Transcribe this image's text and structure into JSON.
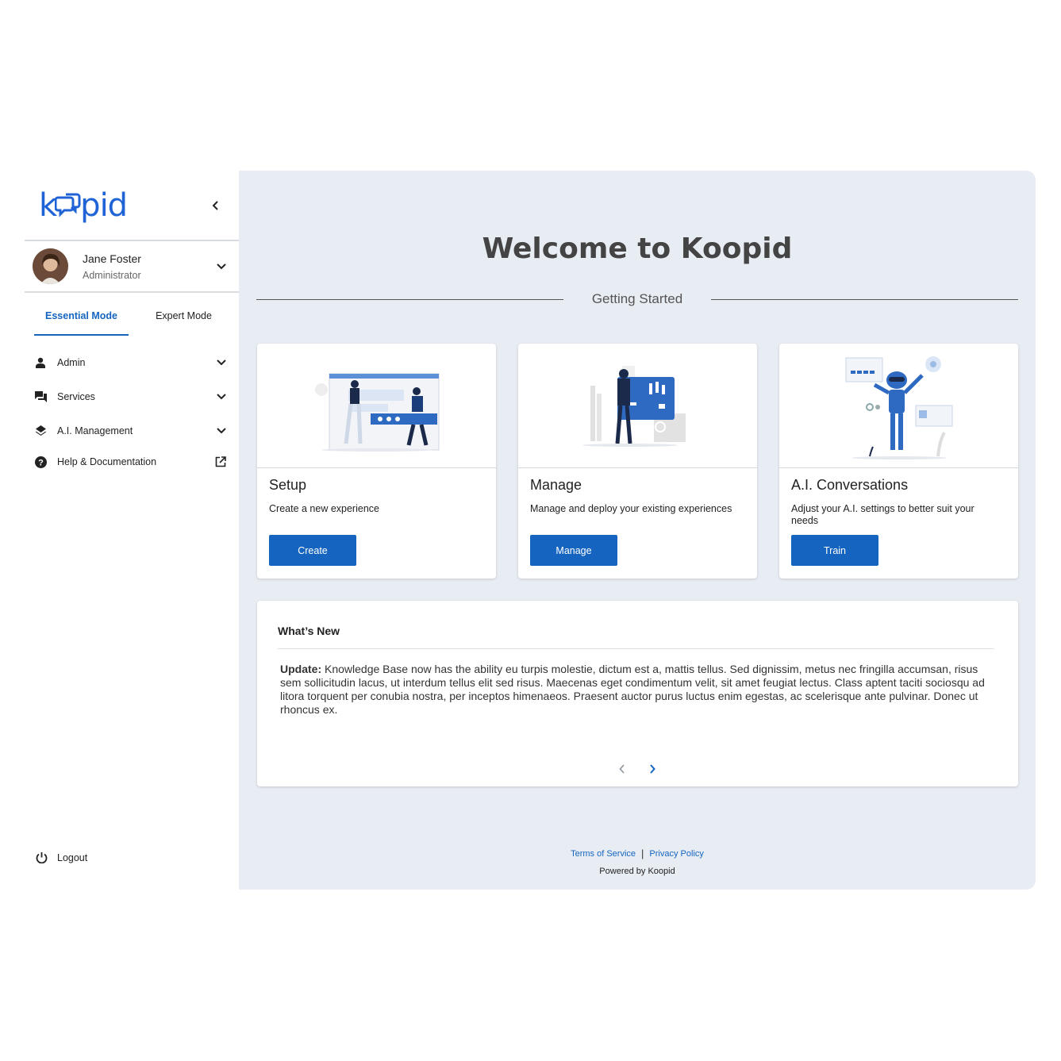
{
  "app": {
    "name": "Koopid"
  },
  "sidebar": {
    "user": {
      "name": "Jane Foster",
      "role": "Administrator"
    },
    "modes": [
      {
        "label": "Essential Mode",
        "active": true
      },
      {
        "label": "Expert Mode",
        "active": false
      }
    ],
    "nav": [
      {
        "label": "Admin",
        "icon": "person-icon",
        "trailing": "chevron-down-icon"
      },
      {
        "label": "Services",
        "icon": "chat-icon",
        "trailing": "chevron-down-icon"
      },
      {
        "label": "A.I. Management",
        "icon": "layers-icon",
        "trailing": "chevron-down-icon"
      },
      {
        "label": "Help & Documentation",
        "icon": "help-icon",
        "trailing": "external-link-icon"
      }
    ],
    "logout_label": "Logout"
  },
  "main": {
    "title": "Welcome to Koopid",
    "section": "Getting Started",
    "cards": [
      {
        "title": "Setup",
        "description": "Create a new experience",
        "button": "Create"
      },
      {
        "title": "Manage",
        "description": "Manage and deploy your existing experiences",
        "button": "Manage"
      },
      {
        "title": "A.I. Conversations",
        "description": "Adjust your A.I. settings to better suit your needs",
        "button": "Train"
      }
    ],
    "news": {
      "title": "What’s New",
      "prefix": "Update:",
      "body": " Knowledge Base now has the ability  eu turpis molestie, dictum est a, mattis tellus. Sed dignissim, metus nec fringilla accumsan, risus sem sollicitudin lacus, ut interdum tellus elit sed risus. Maecenas eget condimentum velit, sit amet feugiat lectus. Class aptent taciti sociosqu ad litora torquent per conubia nostra, per inceptos himenaeos. Praesent auctor purus luctus enim egestas, ac scelerisque ante pulvinar. Donec ut rhoncus ex."
    },
    "footer": {
      "terms": "Terms of Service",
      "separator": "|",
      "privacy": "Privacy Policy",
      "powered": "Powered by Koopid"
    }
  },
  "colors": {
    "accent": "#1565c0",
    "brand": "#1f63d6",
    "main_bg": "#e8ecf3"
  }
}
